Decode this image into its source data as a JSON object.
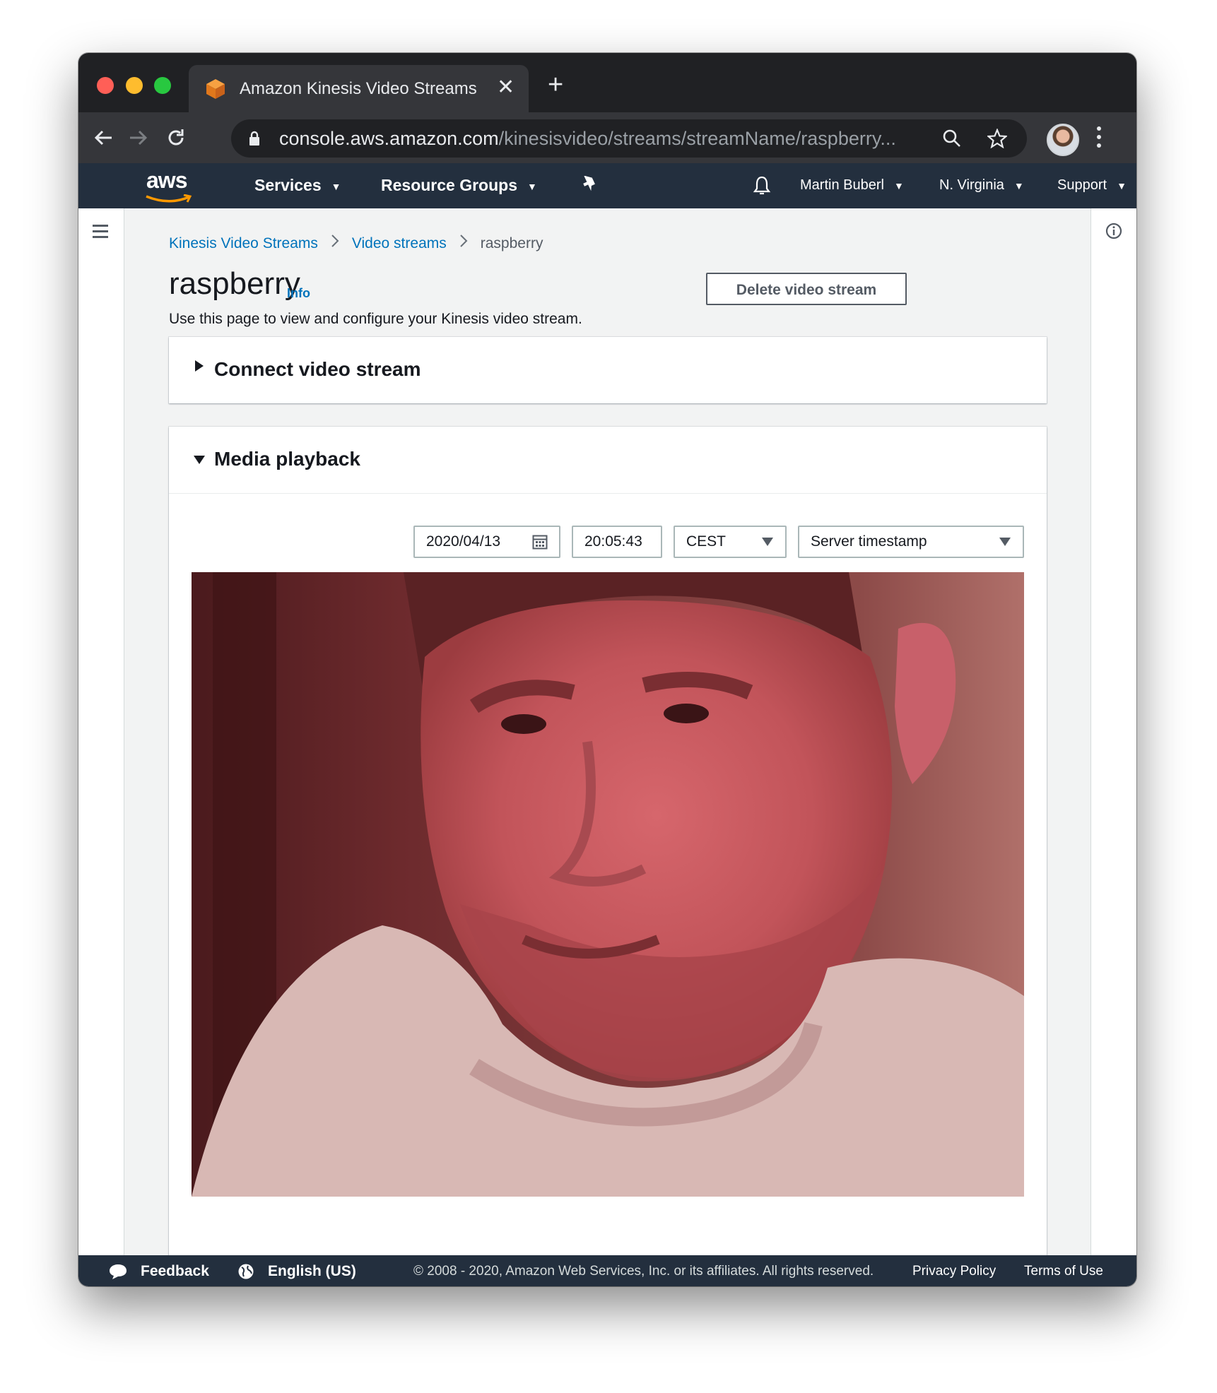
{
  "browser": {
    "tab_title": "Amazon Kinesis Video Streams",
    "url_host": "console.aws.amazon.com",
    "url_path": "/kinesisvideo/streams/streamName/raspberry..."
  },
  "aws_nav": {
    "logo": "aws",
    "services": "Services",
    "resource_groups": "Resource Groups",
    "user": "Martin Buberl",
    "region": "N. Virginia",
    "support": "Support"
  },
  "breadcrumb": {
    "items": [
      "Kinesis Video Streams",
      "Video streams",
      "raspberry"
    ]
  },
  "page": {
    "title": "raspberry",
    "info_link": "Info",
    "description": "Use this page to view and configure your Kinesis video stream.",
    "delete_button": "Delete video stream"
  },
  "panels": {
    "connect": {
      "title": "Connect video stream",
      "expanded": false
    },
    "playback": {
      "title": "Media playback",
      "expanded": true
    }
  },
  "playback": {
    "date": "2020/04/13",
    "time": "20:05:43",
    "timezone": "CEST",
    "timestamp_type": "Server timestamp"
  },
  "footer": {
    "feedback": "Feedback",
    "language": "English (US)",
    "copyright": "© 2008 - 2020, Amazon Web Services, Inc. or its affiliates. All rights reserved.",
    "privacy": "Privacy Policy",
    "terms": "Terms of Use"
  },
  "colors": {
    "aws_nav_bg": "#232f3e",
    "link": "#0073bb",
    "aws_orange": "#ff9900"
  }
}
